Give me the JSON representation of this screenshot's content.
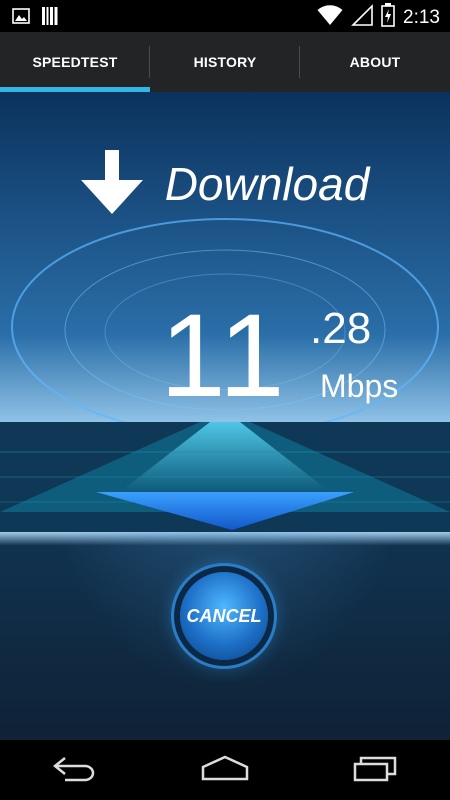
{
  "status_bar": {
    "time": "2:13",
    "icons": [
      "image-icon",
      "barcode-icon",
      "wifi-icon",
      "signal-icon",
      "battery-charging-icon"
    ]
  },
  "tabs": [
    {
      "label": "SPEEDTEST",
      "selected": true
    },
    {
      "label": "HISTORY",
      "selected": false
    },
    {
      "label": "ABOUT",
      "selected": false
    }
  ],
  "test": {
    "mode": "Download",
    "speed_integer": "11",
    "speed_decimal": ".28",
    "unit": "Mbps"
  },
  "cancel_button": {
    "label": "CANCEL"
  },
  "colors": {
    "accent": "#33b5e5",
    "tab_bar": "#222426",
    "background": "#0f2236"
  },
  "nav_bar": {
    "buttons": [
      "back-icon",
      "home-icon",
      "recent-apps-icon"
    ]
  }
}
